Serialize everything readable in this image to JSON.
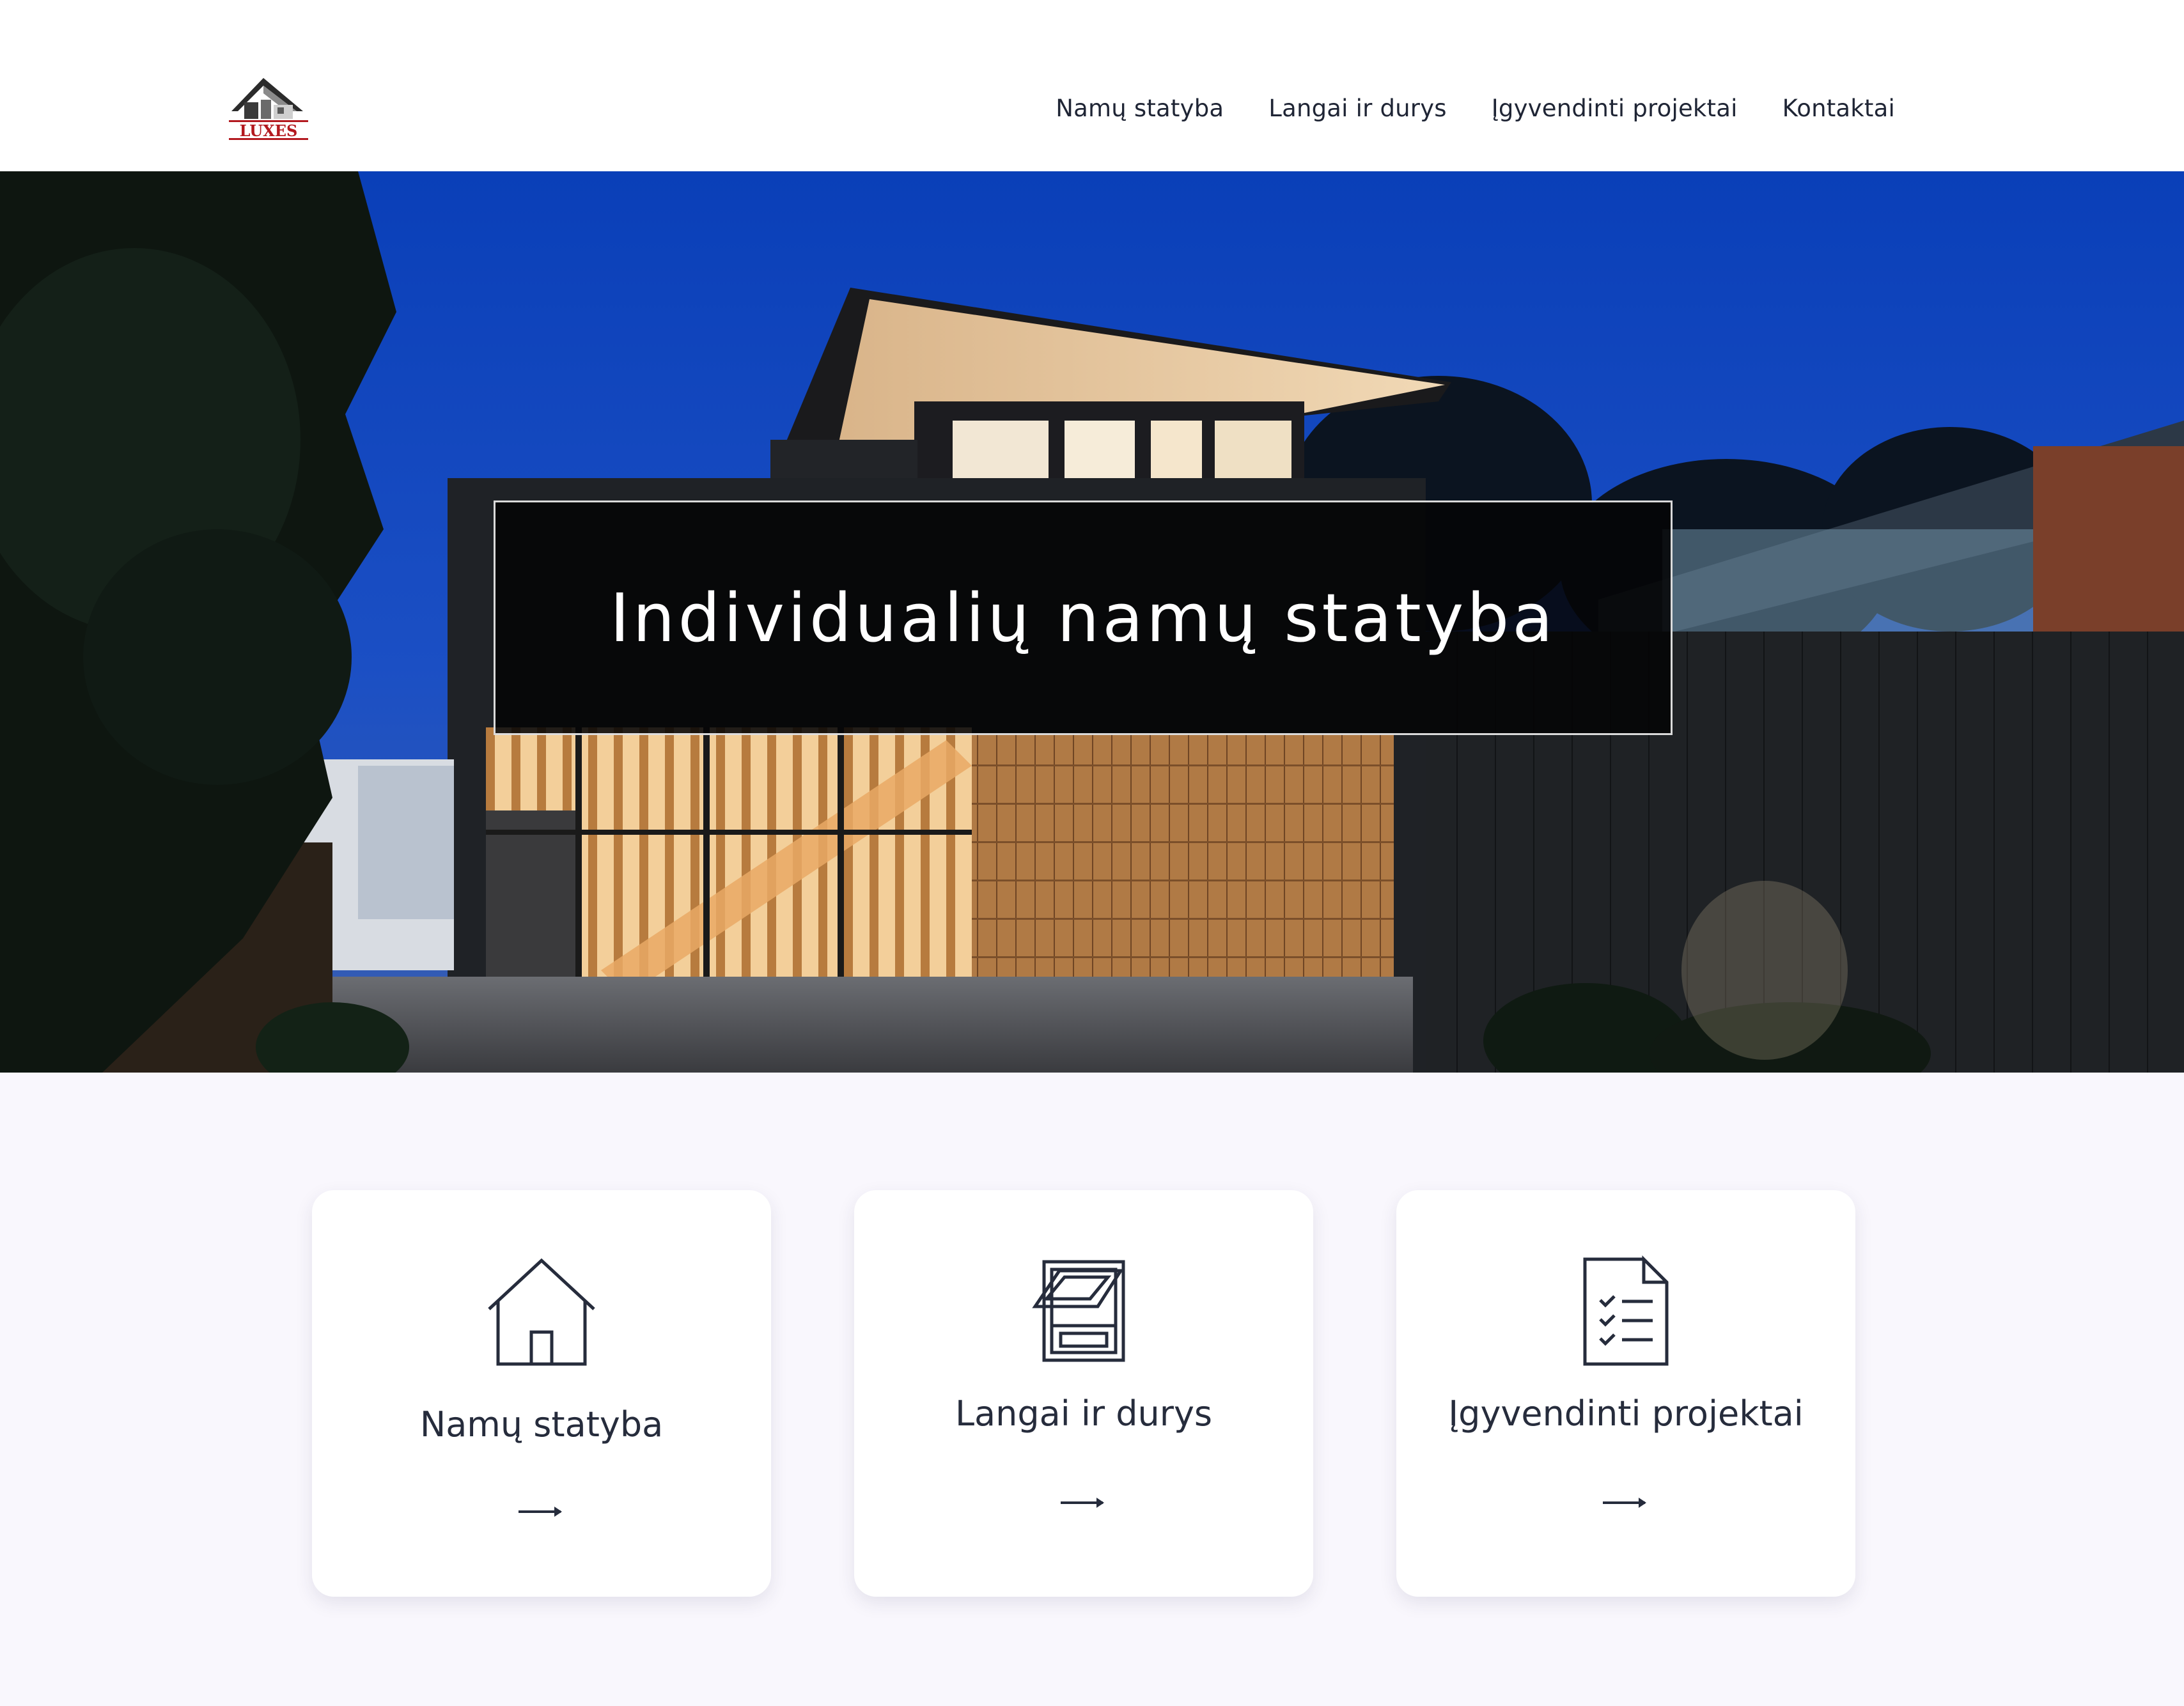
{
  "brand": {
    "logo_text": "LUXES"
  },
  "nav": {
    "items": [
      {
        "label": "Namų statyba"
      },
      {
        "label": "Langai ir durys"
      },
      {
        "label": "Įgyvendinti projektai"
      },
      {
        "label": "Kontaktai"
      }
    ]
  },
  "hero": {
    "title": "Individualių namų statyba"
  },
  "cards": [
    {
      "title": "Namų statyba",
      "icon": "house-icon"
    },
    {
      "title": "Langai ir durys",
      "icon": "window-icon"
    },
    {
      "title": "Įgyvendinti projektai",
      "icon": "checklist-document-icon"
    }
  ],
  "colors": {
    "text_dark": "#1f2535",
    "page_bg": "#f9f7fd",
    "card_bg": "#ffffff",
    "logo_red": "#b3191f"
  }
}
